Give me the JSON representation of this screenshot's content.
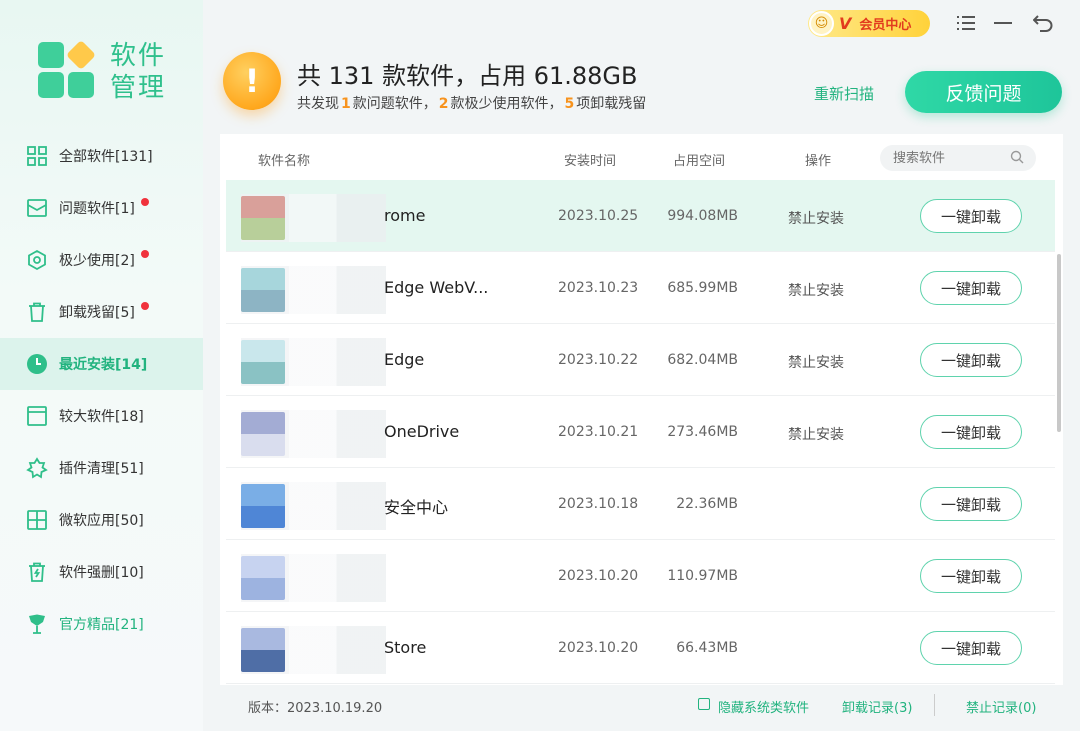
{
  "app": {
    "logo_line1": "软件",
    "logo_line2": "管理"
  },
  "header": {
    "vip_label": "会员中心",
    "vip_v": "V",
    "summary_title": "共 131 款软件，占用 61.88GB",
    "sub_prefix": "共发现",
    "sub_count1": "1",
    "sub_text1": "款问题软件，",
    "sub_count2": "2",
    "sub_text2": "款极少使用软件，",
    "sub_count3": "5",
    "sub_text3": "项卸载残留",
    "rescan_label": "重新扫描",
    "feedback_label": "反馈问题"
  },
  "sidebar": {
    "items": [
      {
        "label": "全部软件[131]",
        "icon": "grid-icon",
        "dot": false
      },
      {
        "label": "问题软件[1]",
        "icon": "mail-icon",
        "dot": true
      },
      {
        "label": "极少使用[2]",
        "icon": "hexagon-icon",
        "dot": true
      },
      {
        "label": "卸载残留[5]",
        "icon": "trash-icon",
        "dot": true
      },
      {
        "label": "最近安装[14]",
        "icon": "clock-icon",
        "dot": false,
        "active": true
      },
      {
        "label": "较大软件[18]",
        "icon": "window-icon",
        "dot": false
      },
      {
        "label": "插件清理[51]",
        "icon": "puzzle-icon",
        "dot": false
      },
      {
        "label": "微软应用[50]",
        "icon": "windows-icon",
        "dot": false
      },
      {
        "label": "软件强删[10]",
        "icon": "force-delete-icon",
        "dot": false
      },
      {
        "label": "官方精品[21]",
        "icon": "premium-icon",
        "dot": false,
        "highlight": true
      }
    ]
  },
  "table": {
    "headers": {
      "name": "软件名称",
      "date": "安装时间",
      "size": "占用空间",
      "op": "操作"
    },
    "search_placeholder": "搜索软件",
    "uninstall_label": "一键卸载",
    "rows": [
      {
        "name": "rome",
        "date": "2023.10.25",
        "size": "994.08MB",
        "op": "禁止安装",
        "selected": true,
        "c1": "#d9a09a",
        "c2": "#b8cf9a"
      },
      {
        "name": "Edge WebV...",
        "date": "2023.10.23",
        "size": "685.99MB",
        "op": "禁止安装",
        "c1": "#a7d6dc",
        "c2": "#8db4c4"
      },
      {
        "name": "Edge",
        "date": "2023.10.22",
        "size": "682.04MB",
        "op": "禁止安装",
        "c1": "#c9e7ec",
        "c2": "#8ac2c4"
      },
      {
        "name": "OneDrive",
        "date": "2023.10.21",
        "size": "273.46MB",
        "op": "禁止安装",
        "c1": "#a3acd4",
        "c2": "#d9ddee"
      },
      {
        "name": "安全中心",
        "date": "2023.10.18",
        "size": "22.36MB",
        "op": "",
        "c1": "#7aaee6",
        "c2": "#4f86d6"
      },
      {
        "name": "",
        "date": "2023.10.20",
        "size": "110.97MB",
        "op": "",
        "c1": "#c7d3f0",
        "c2": "#9db3e0"
      },
      {
        "name": "Store",
        "date": "2023.10.20",
        "size": "66.43MB",
        "op": "",
        "c1": "#a9b9e0",
        "c2": "#4f6ea6"
      }
    ]
  },
  "footer": {
    "version": "版本：2023.10.19.20",
    "hide_system": "隐藏系统类软件",
    "uninstall_log": "卸载记录(3)",
    "ban_log": "禁止记录(0)"
  },
  "colors": {
    "accent": "#22b37f",
    "warning": "#f7931e",
    "dot": "#f0323c"
  }
}
